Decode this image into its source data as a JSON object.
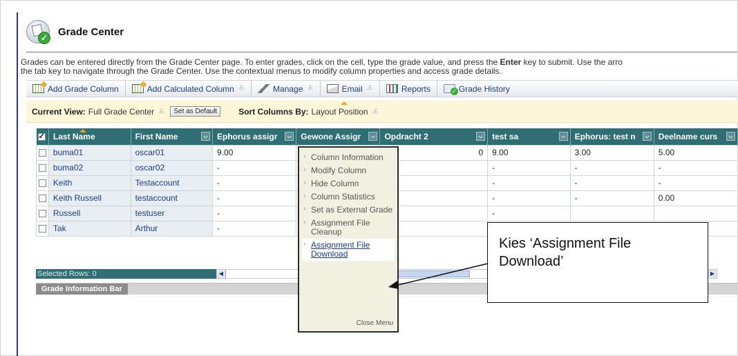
{
  "header": {
    "title": "Grade Center"
  },
  "intro": {
    "line1_a": "Grades can be entered directly from the Grade Center page. To enter grades, click on the cell, type the grade value, and press the ",
    "line1_bold": "Enter",
    "line1_b": " key to submit. Use the arro",
    "line2": "the tab key to navigate through the Grade Center. Use the contextual menus to modify column properties and access grade details."
  },
  "toolbar": {
    "add_grade_column": "Add Grade Column",
    "add_calculated_column": "Add Calculated Column",
    "manage": "Manage",
    "email": "Email",
    "reports": "Reports",
    "grade_history": "Grade History"
  },
  "viewbar": {
    "current_view_label": "Current View:",
    "current_view_value": "Full Grade Center",
    "set_default": "Set as Default",
    "sort_label": "Sort Columns By:",
    "sort_value": "Layout Position"
  },
  "grid": {
    "headers": [
      "Last Name",
      "First Name",
      "Ephorus assigr",
      "Gewone Assigr",
      "Opdracht 2",
      "test sa",
      "Ephorus: test n",
      "Deelname curs"
    ],
    "rows": [
      {
        "last": "buma01",
        "first": "oscar01",
        "c1": "9.00",
        "c2": "",
        "c3": "0",
        "c4": "9.00",
        "c5": "3.00",
        "c6": "5.00"
      },
      {
        "last": "buma02",
        "first": "oscar02",
        "c1": "-",
        "c2": "",
        "c3": "",
        "c4": "-",
        "c5": "-",
        "c6": "-"
      },
      {
        "last": "Keith",
        "first": "Testaccount",
        "c1": "-",
        "c2": "",
        "c3": "",
        "c4": "-",
        "c5": "-",
        "c6": "-"
      },
      {
        "last": "Keith Russell",
        "first": "testaccount",
        "c1": "-",
        "c2": "",
        "c3": "",
        "c4": "-",
        "c5": "-",
        "c6": "0.00"
      },
      {
        "last": "Russell",
        "first": "testuser",
        "c1": "-",
        "c2": "",
        "c3": "",
        "c4": "-",
        "c5": "",
        "c6": ""
      },
      {
        "last": "Tak",
        "first": "Arthur",
        "c1": "-",
        "c2": "",
        "c3": "",
        "c4": "",
        "c5": "",
        "c6": ""
      }
    ],
    "selected_rows": "Selected Rows: 0"
  },
  "info_bar": {
    "label": "Grade Information Bar"
  },
  "context_menu": {
    "items": [
      "Column Information",
      "Modify Column",
      "Hide Column",
      "Column Statistics",
      "Set as External Grade",
      "Assignment File Cleanup",
      "Assignment File Download"
    ],
    "close": "Close Menu"
  },
  "callout": {
    "text": "Kies ‘Assignment File Download’"
  }
}
